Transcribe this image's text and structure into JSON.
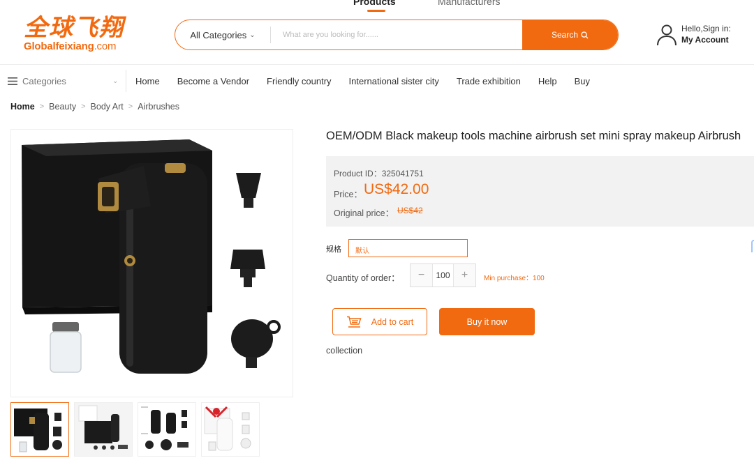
{
  "top_tabs": {
    "products": "Products",
    "manufacturers": "Manufacturers"
  },
  "logo": {
    "cn": "全球飞翔",
    "en_main": "Globalfeixiang",
    "en_domain": ".com"
  },
  "search": {
    "category": "All Categories",
    "placeholder": "What are you looking for......",
    "button": "Search"
  },
  "account": {
    "greeting": "Hello,Sign in:",
    "label": "My Account"
  },
  "nav": {
    "categories": "Categories",
    "links": [
      "Home",
      "Become a Vendor",
      "Friendly country",
      "International sister city",
      "Trade exhibition",
      "Help",
      "Buy"
    ]
  },
  "breadcrumb": [
    "Home",
    "Beauty",
    "Body Art",
    "Airbrushes"
  ],
  "product": {
    "title": "OEM/ODM Black makeup tools machine airbrush set mini spray makeup Airbrush",
    "id_text": "Product ID：325041751",
    "price_label": "Price：",
    "price": "US$42.00",
    "original_label": "Original price：",
    "original_price": "US$42",
    "spec_label": "规格",
    "spec_option": "默认",
    "qty_label": "Quantity of order：",
    "qty": "100",
    "min_purchase": "Min purchase：100",
    "add_to_cart": "Add to cart",
    "buy_now": "Buy it now",
    "collection": "collection"
  },
  "colors": {
    "accent": "#f26a10"
  }
}
